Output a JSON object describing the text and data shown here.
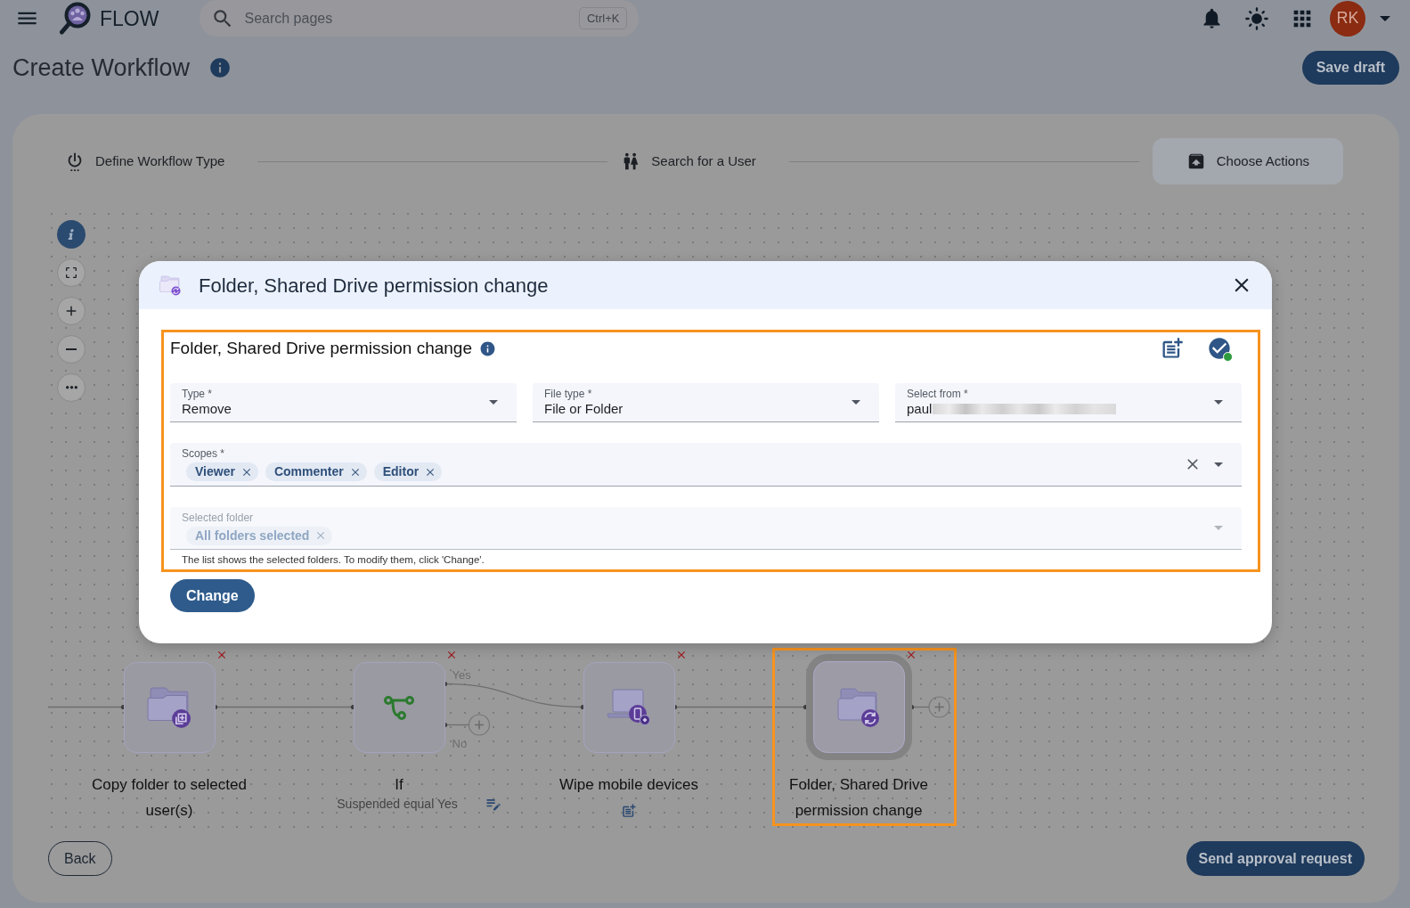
{
  "topbar": {
    "brand": "FLOW",
    "search": {
      "placeholder": "Search pages",
      "shortcut": "Ctrl+K"
    },
    "avatar": "RK"
  },
  "page": {
    "title": "Create Workflow",
    "save_button": "Save draft"
  },
  "stepper": [
    {
      "kind": "power",
      "label": "Define Workflow Type",
      "selected": false
    },
    {
      "kind": "people",
      "label": "Search for a User",
      "selected": false
    },
    {
      "kind": "actions",
      "label": "Choose Actions",
      "selected": true
    }
  ],
  "workflow": {
    "nodes": [
      {
        "kind": "copy_folder",
        "label": "Copy folder to selected user(s)",
        "selected": false
      },
      {
        "kind": "condition",
        "label": "If",
        "subtitle": "Suspended equal Yes",
        "note": {
          "kind": "edit"
        },
        "branches": [
          "Yes",
          "No"
        ],
        "selected": false
      },
      {
        "kind": "wipe_device",
        "label": "Wipe mobile devices",
        "note": {
          "kind": "add"
        },
        "selected": false
      },
      {
        "kind": "permission_change",
        "label": "Folder, Shared Drive permission change",
        "selected": true
      }
    ]
  },
  "modal": {
    "title": "Folder, Shared Drive permission change",
    "section": {
      "title": "Folder, Shared Drive permission change",
      "fields": [
        {
          "label": "Type *",
          "value": "Remove",
          "redacted": false
        },
        {
          "label": "File type *",
          "value": "File or Folder",
          "redacted": false
        },
        {
          "label": "Select from *",
          "value": "paul",
          "redacted": true
        }
      ],
      "scopes": {
        "label": "Scopes *",
        "chips": [
          "Viewer",
          "Commenter",
          "Editor"
        ]
      },
      "selected_folder": {
        "label": "Selected folder",
        "chips": [
          "All folders selected"
        ],
        "disabled": true
      },
      "helper": "The list shows the selected folders. To modify them, click 'Change'."
    },
    "change_button": "Change"
  },
  "footer": {
    "back_button": "Back",
    "send_button": "Send approval request"
  }
}
